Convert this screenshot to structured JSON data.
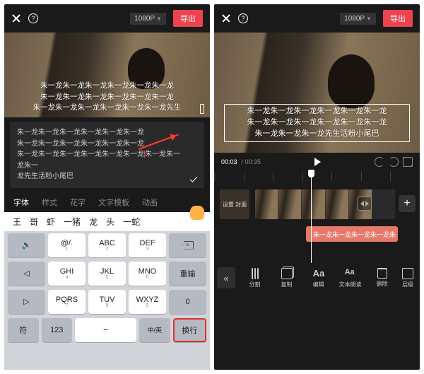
{
  "topbar": {
    "resolution": "1080P",
    "export": "导出"
  },
  "overlay": {
    "line1": "朱一龙朱一龙朱一龙朱一龙朱一龙朱一龙",
    "line2": "朱一龙朱一龙朱一龙朱一龙朱一龙朱一龙",
    "line3": "朱一龙朱一龙朱一龙朱一龙朱一龙朱一龙先生",
    "line3r": "朱一龙朱一龙朱一龙先生活粉小尾巴"
  },
  "editor": {
    "l1": "朱一龙朱一龙朱一龙朱一龙朱一龙朱一龙",
    "l2": "朱一龙朱一龙朱一龙朱一龙朱一龙朱一龙",
    "l3a": "朱一龙朱一龙朱一龙朱一龙朱一龙朱一龙",
    "l3b": "朱一龙朱一龙朱一",
    "l4": "龙先生活粉小尾巴"
  },
  "textTabs": {
    "font": "字体",
    "style": "样式",
    "flower": "花字",
    "template": "文字模板",
    "anim": "动画"
  },
  "candidates": {
    "c1": "王",
    "c2": "哥",
    "c3": "虾",
    "c4": "一猪",
    "c5": "龙",
    "c6": "头",
    "c7": "一蛇"
  },
  "keys": {
    "k1": "@/.",
    "k1h": "1",
    "k2": "ABC",
    "k2h": "2",
    "k3": "DEF",
    "k3h": "3",
    "k4": "GHI",
    "k4h": "4",
    "k5": "JKL",
    "k5h": "5",
    "k6": "MNO",
    "k6h": "6",
    "redo": "重输",
    "k7": "PQRS",
    "k7h": "7",
    "k8": "TUV",
    "k8h": "8",
    "k9": "WXYZ",
    "k9h": "9",
    "zero": "0",
    "sym": "符",
    "num": "123",
    "lang": "中/英",
    "enter": "换行"
  },
  "time": {
    "cur": "00:03",
    "total": "00:35"
  },
  "cover": "设置\n封面",
  "textTrack": "朱一龙朱一龙朱一龙朱一龙朱",
  "tools": {
    "split": "分割",
    "copy": "复制",
    "edit": "编辑",
    "read": "文本朗读",
    "delete": "删除",
    "layer": "层级"
  }
}
